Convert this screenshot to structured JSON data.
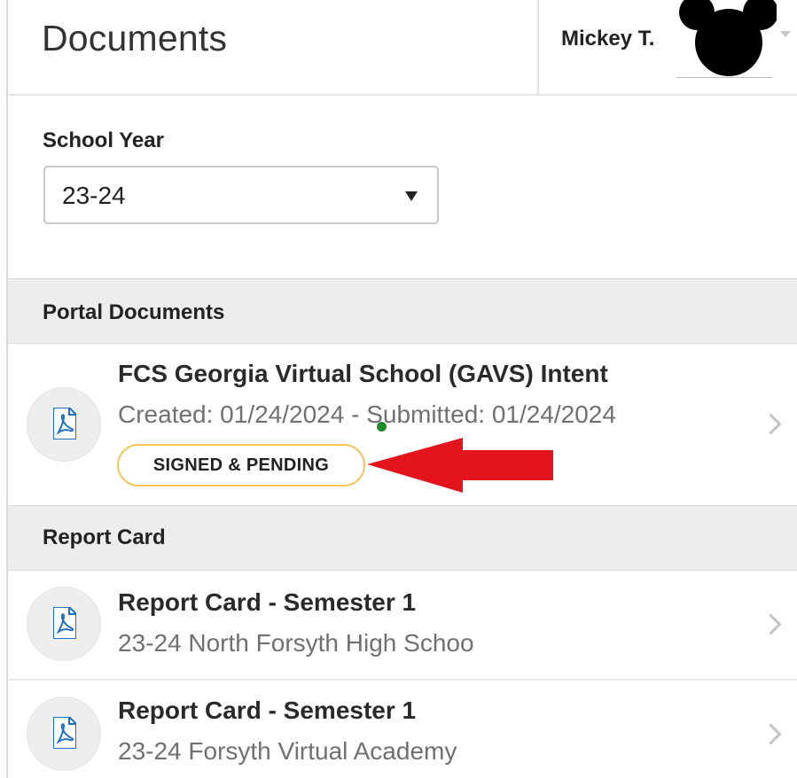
{
  "header": {
    "title": "Documents",
    "user_name": "Mickey T."
  },
  "school_year": {
    "label": "School Year",
    "selected": "23-24"
  },
  "sections": [
    {
      "title": "Portal Documents",
      "items": [
        {
          "title": "FCS Georgia Virtual School (GAVS) Intent",
          "subtitle": "Created: 01/24/2024 - Submitted: 01/24/2024",
          "badge": "SIGNED & PENDING",
          "icon": "pdf-icon"
        }
      ]
    },
    {
      "title": "Report Card",
      "items": [
        {
          "title": "Report Card - Semester 1",
          "subtitle": "23-24 North Forsyth High Schoo",
          "icon": "pdf-icon"
        },
        {
          "title": "Report Card - Semester 1",
          "subtitle": "23-24 Forsyth Virtual Academy",
          "icon": "pdf-icon"
        }
      ]
    }
  ],
  "colors": {
    "badge_border": "#f0c75e",
    "annotation_arrow": "#e3141c",
    "pdf_icon": "#1f6fc2",
    "section_bg": "#ededed"
  }
}
